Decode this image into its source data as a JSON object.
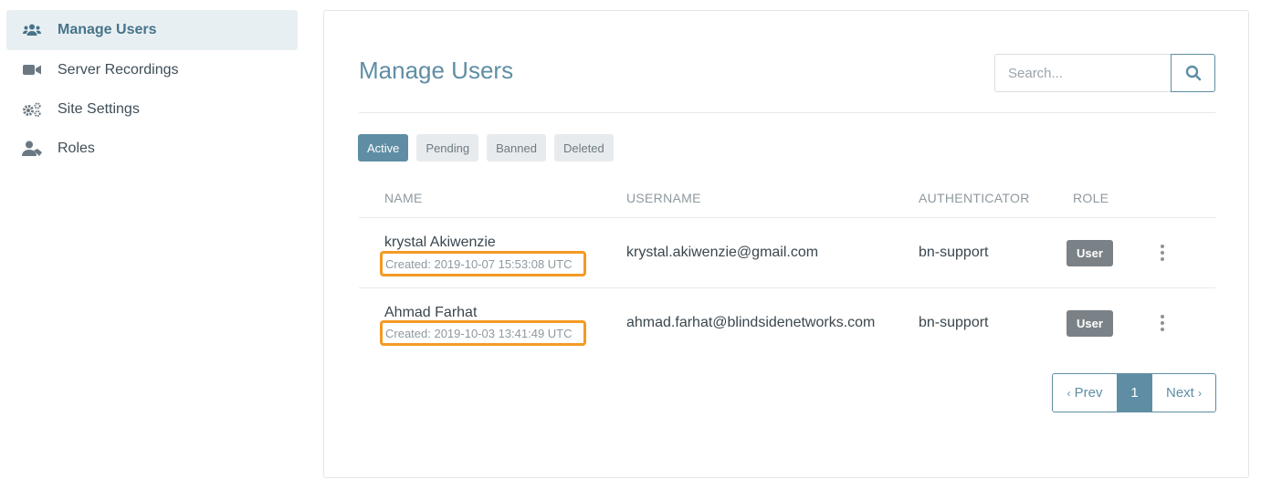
{
  "sidebar": {
    "items": [
      {
        "label": "Manage Users",
        "icon": "users-icon",
        "active": true
      },
      {
        "label": "Server Recordings",
        "icon": "video-camera-icon",
        "active": false
      },
      {
        "label": "Site Settings",
        "icon": "cogs-icon",
        "active": false
      },
      {
        "label": "Roles",
        "icon": "user-tag-icon",
        "active": false
      }
    ]
  },
  "main": {
    "title": "Manage Users",
    "search": {
      "placeholder": "Search...",
      "value": ""
    },
    "tabs": [
      {
        "label": "Active",
        "active": true
      },
      {
        "label": "Pending",
        "active": false
      },
      {
        "label": "Banned",
        "active": false
      },
      {
        "label": "Deleted",
        "active": false
      }
    ],
    "table": {
      "columns": [
        "NAME",
        "USERNAME",
        "AUTHENTICATOR",
        "ROLE"
      ],
      "rows": [
        {
          "name": "krystal Akiwenzie",
          "created": "Created: 2019-10-07 15:53:08 UTC",
          "username": "krystal.akiwenzie@gmail.com",
          "authenticator": "bn-support",
          "role": "User"
        },
        {
          "name": "Ahmad Farhat",
          "created": "Created: 2019-10-03 13:41:49 UTC",
          "username": "ahmad.farhat@blindsidenetworks.com",
          "authenticator": "bn-support",
          "role": "User"
        }
      ]
    },
    "pagination": {
      "prev": "Prev",
      "current": "1",
      "next": "Next"
    }
  },
  "colors": {
    "accent": "#5f8ea4",
    "highlight": "#f59a23",
    "badge": "#7b8287"
  }
}
